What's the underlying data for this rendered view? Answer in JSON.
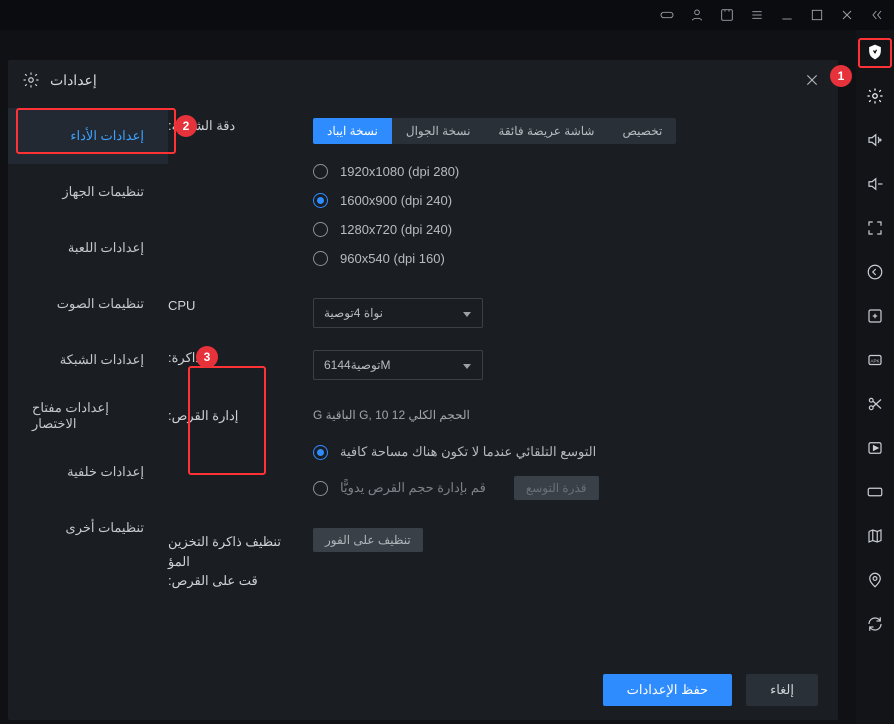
{
  "top_menubar": {
    "icons": [
      "gamepad",
      "user",
      "screenshot",
      "bars",
      "min",
      "max",
      "close",
      "chevrons"
    ]
  },
  "right_sidebar_icons": [
    "shield",
    "settings-gear",
    "vol-up",
    "vol-mute",
    "fullscreen",
    "back",
    "add-tile",
    "apk",
    "scissors",
    "play-box",
    "keyboard-box",
    "map",
    "pin",
    "rotate"
  ],
  "callouts": {
    "c1": "1",
    "c2": "2",
    "c3": "3"
  },
  "settings": {
    "title": "إعدادات",
    "tabs": [
      "إعدادات الأداء",
      "تنظيمات الجهاز",
      "إعدادات اللعبة",
      "تنظيمات الصوت",
      "إعدادات الشبكة",
      "إعدادات مفتاح الاختصار",
      "إعدادات خلفية",
      "تنظيمات أخرى"
    ],
    "active_tab": 0,
    "resolution": {
      "label": ":دقة الشاشة",
      "modes": [
        {
          "label": "نسخة ايباد",
          "active": true
        },
        {
          "label": "نسخة الجوال",
          "active": false
        },
        {
          "label": "شاشة عريضة فائقة",
          "active": false
        },
        {
          "label": "تخصيص",
          "active": false
        }
      ],
      "options": [
        {
          "text": "1920x1080  (dpi 280)",
          "selected": false
        },
        {
          "text": "1600x900  (dpi 240)",
          "selected": true
        },
        {
          "text": "1280x720  (dpi 240)",
          "selected": false
        },
        {
          "text": "960x540  (dpi 160)",
          "selected": false
        }
      ]
    },
    "cpu": {
      "label": "CPU",
      "value": "نواة 4توصية"
    },
    "memory": {
      "label": ":الذاكرة",
      "value": "توصية6144M"
    },
    "disk": {
      "label": ":إدارة القرص",
      "info": "G الباقية G,  10 الحجم الكلي 12",
      "auto_expand": "التوسع التلقائي عندما لا تكون هناك مساحة كافية",
      "manual_expand": "قم بإدارة حجم القرص يدويًّا",
      "expand_btn": "قذرة التوسع"
    },
    "clear_cache": {
      "label1": "تنظيف ذاكرة التخزين المؤ",
      "label2": ":قت على القرص",
      "btn": "تنظيف على الفور"
    },
    "footer": {
      "save": "حفظ الإعدادات",
      "cancel": "إلغاء"
    }
  }
}
